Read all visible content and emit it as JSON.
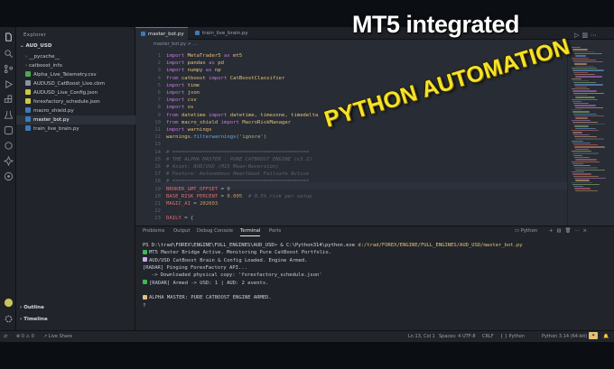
{
  "overlay": {
    "top_text": "MT5 integrated",
    "diagonal_text": "PYTHON AUTOMATION"
  },
  "colors": {
    "accent_yellow": "#f5e22a",
    "tab_accent": "#4d78cc",
    "python_icon": "#3d7ab8",
    "json_icon": "#cbcb41"
  },
  "activity_bar": {
    "icons": [
      "files-icon",
      "search-icon",
      "source-control-icon",
      "run-debug-icon",
      "extensions-icon",
      "testing-icon",
      "python-icon",
      "remote-icon",
      "copilot-icon",
      "github-icon"
    ],
    "bottom_icons": [
      "account-icon",
      "settings-icon"
    ]
  },
  "sidebar": {
    "title": "Explorer",
    "root": "AUD_USD",
    "items": [
      {
        "label": "__pycache__",
        "type": "folder"
      },
      {
        "label": "catboost_info",
        "type": "folder"
      },
      {
        "label": "Alpha_Live_Telemetry.csv",
        "type": "csv"
      },
      {
        "label": "AUDUSD_CatBoost_Live.cbm",
        "type": "file"
      },
      {
        "label": "AUDUSD_Live_Config.json",
        "type": "json"
      },
      {
        "label": "forexfactory_schedule.json",
        "type": "json"
      },
      {
        "label": "macro_shield.py",
        "type": "py"
      },
      {
        "label": "master_bot.py",
        "type": "py",
        "selected": true
      },
      {
        "label": "train_live_brain.py",
        "type": "py"
      }
    ],
    "outline": "Outline",
    "timeline": "Timeline"
  },
  "tabs": [
    {
      "label": "master_bot.py",
      "close": "×"
    },
    {
      "label": "train_live_brain.py"
    }
  ],
  "breadcrumb": "master_bot.py > ...",
  "code": [
    {
      "n": "1",
      "parts": [
        [
          "kw",
          "import "
        ],
        [
          "mod",
          "MetaTrader5 "
        ],
        [
          "kw",
          "as "
        ],
        [
          "mod",
          "mt5"
        ]
      ]
    },
    {
      "n": "2",
      "parts": [
        [
          "kw",
          "import "
        ],
        [
          "mod",
          "pandas "
        ],
        [
          "kw",
          "as "
        ],
        [
          "mod",
          "pd"
        ]
      ]
    },
    {
      "n": "3",
      "parts": [
        [
          "kw",
          "import "
        ],
        [
          "mod",
          "numpy "
        ],
        [
          "kw",
          "as "
        ],
        [
          "mod",
          "np"
        ]
      ]
    },
    {
      "n": "4",
      "parts": [
        [
          "kw",
          "from "
        ],
        [
          "mod",
          "catboost "
        ],
        [
          "kw",
          "import "
        ],
        [
          "mod",
          "CatBoostClassifier"
        ]
      ]
    },
    {
      "n": "5",
      "parts": [
        [
          "kw",
          "import "
        ],
        [
          "mod",
          "time"
        ]
      ]
    },
    {
      "n": "6",
      "parts": [
        [
          "kw",
          "import "
        ],
        [
          "mod",
          "json"
        ]
      ]
    },
    {
      "n": "7",
      "parts": [
        [
          "kw",
          "import "
        ],
        [
          "mod",
          "csv"
        ]
      ]
    },
    {
      "n": "8",
      "parts": [
        [
          "kw",
          "import "
        ],
        [
          "mod",
          "os"
        ]
      ]
    },
    {
      "n": "9",
      "parts": [
        [
          "kw",
          "from "
        ],
        [
          "mod",
          "datetime "
        ],
        [
          "kw",
          "import "
        ],
        [
          "mod",
          "datetime, timezone, timedelta"
        ]
      ]
    },
    {
      "n": "10",
      "parts": [
        [
          "kw",
          "from "
        ],
        [
          "mod",
          "macro_shield "
        ],
        [
          "kw",
          "import "
        ],
        [
          "mod",
          "MacroRiskManager"
        ]
      ]
    },
    {
      "n": "11",
      "parts": [
        [
          "kw",
          "import "
        ],
        [
          "mod",
          "warnings"
        ]
      ]
    },
    {
      "n": "12",
      "parts": [
        [
          "mod",
          "warnings"
        ],
        [
          "txt",
          "."
        ],
        [
          "fn",
          "filterwarnings"
        ],
        [
          "txt",
          "("
        ],
        [
          "str",
          "'ignore'"
        ],
        [
          "txt",
          ")"
        ]
      ]
    },
    {
      "n": "13",
      "parts": []
    },
    {
      "n": "14",
      "parts": [
        [
          "cm",
          "# ============================================="
        ]
      ]
    },
    {
      "n": "15",
      "parts": [
        [
          "cm",
          "# THE ALPHA MASTER : PURE CATBOOST ENGINE (v3.2)"
        ]
      ]
    },
    {
      "n": "16",
      "parts": [
        [
          "cm",
          "# Asset: AUD/USD (M15 Mean-Reversion)"
        ]
      ]
    },
    {
      "n": "17",
      "parts": [
        [
          "cm",
          "# Feature: Autonomous Heartbeat Failsafe Active"
        ]
      ]
    },
    {
      "n": "18",
      "parts": [
        [
          "cm",
          "# ============================================="
        ]
      ]
    },
    {
      "n": "19",
      "parts": [
        [
          "var",
          "BROKER_GMT_OFFSET "
        ],
        [
          "txt",
          "= "
        ],
        [
          "num",
          "0"
        ]
      ]
    },
    {
      "n": "20",
      "parts": [
        [
          "var",
          "BASE_RISK_PERCENT "
        ],
        [
          "txt",
          "= "
        ],
        [
          "num",
          "0.005  "
        ],
        [
          "cm",
          "# 0.5% risk per setup"
        ]
      ]
    },
    {
      "n": "21",
      "parts": [
        [
          "var",
          "MAGIC_AI "
        ],
        [
          "txt",
          "= "
        ],
        [
          "num",
          "202603"
        ]
      ]
    },
    {
      "n": "22",
      "parts": []
    },
    {
      "n": "23",
      "parts": [
        [
          "var",
          "DAILY "
        ],
        [
          "txt",
          "= {"
        ]
      ]
    }
  ],
  "panel": {
    "tabs": [
      "Problems",
      "Output",
      "Debug Console",
      "Terminal",
      "Ports"
    ],
    "active_tab": "Terminal",
    "shell": "Python",
    "lines": [
      {
        "kind": "prompt",
        "path": "PS D:\\trad\\FOREX\\ENGINE\\FULL_ENGINES\\AUD_USD> & C:\\Python314\\python.exe ",
        "cmd": "d:/trad/FOREX/ENGINE/FULL_ENGINES/AUD_USD/master_bot.py"
      },
      {
        "kind": "out",
        "icon": "#3fb950",
        "text": "MT5 Master Bridge Active. Monitoring Pure CatBoost Portfolio."
      },
      {
        "kind": "out",
        "icon": "#d2a8ff",
        "text": "AUD/USD CatBoost Brain & Config Loaded. Engine Armed."
      },
      {
        "kind": "out",
        "icon": "",
        "text": "[RADAR] Pinging ForexFactory API..."
      },
      {
        "kind": "out",
        "icon": "",
        "text": "   -> Downloaded physical copy: 'forexfactory_schedule.json'"
      },
      {
        "kind": "out",
        "icon": "#3fb950",
        "text": "[RADAR] Armed -> USD: 1 | AUD: 2 events."
      },
      {
        "kind": "blank",
        "text": ""
      },
      {
        "kind": "out",
        "icon": "#e5c07b",
        "text": "ALPHA MASTER: PURE CATBOOST ENGINE ARMED."
      },
      {
        "kind": "cursor",
        "text": "▯"
      }
    ]
  },
  "status": {
    "left": [
      "⊗ 0 ⚠ 0",
      "Live Share"
    ],
    "right": [
      "Ln 13, Col 1",
      "Spaces: 4",
      "UTF-8",
      "CRLF",
      "{ } Python",
      "Python 3.14 (64-bit)"
    ]
  }
}
